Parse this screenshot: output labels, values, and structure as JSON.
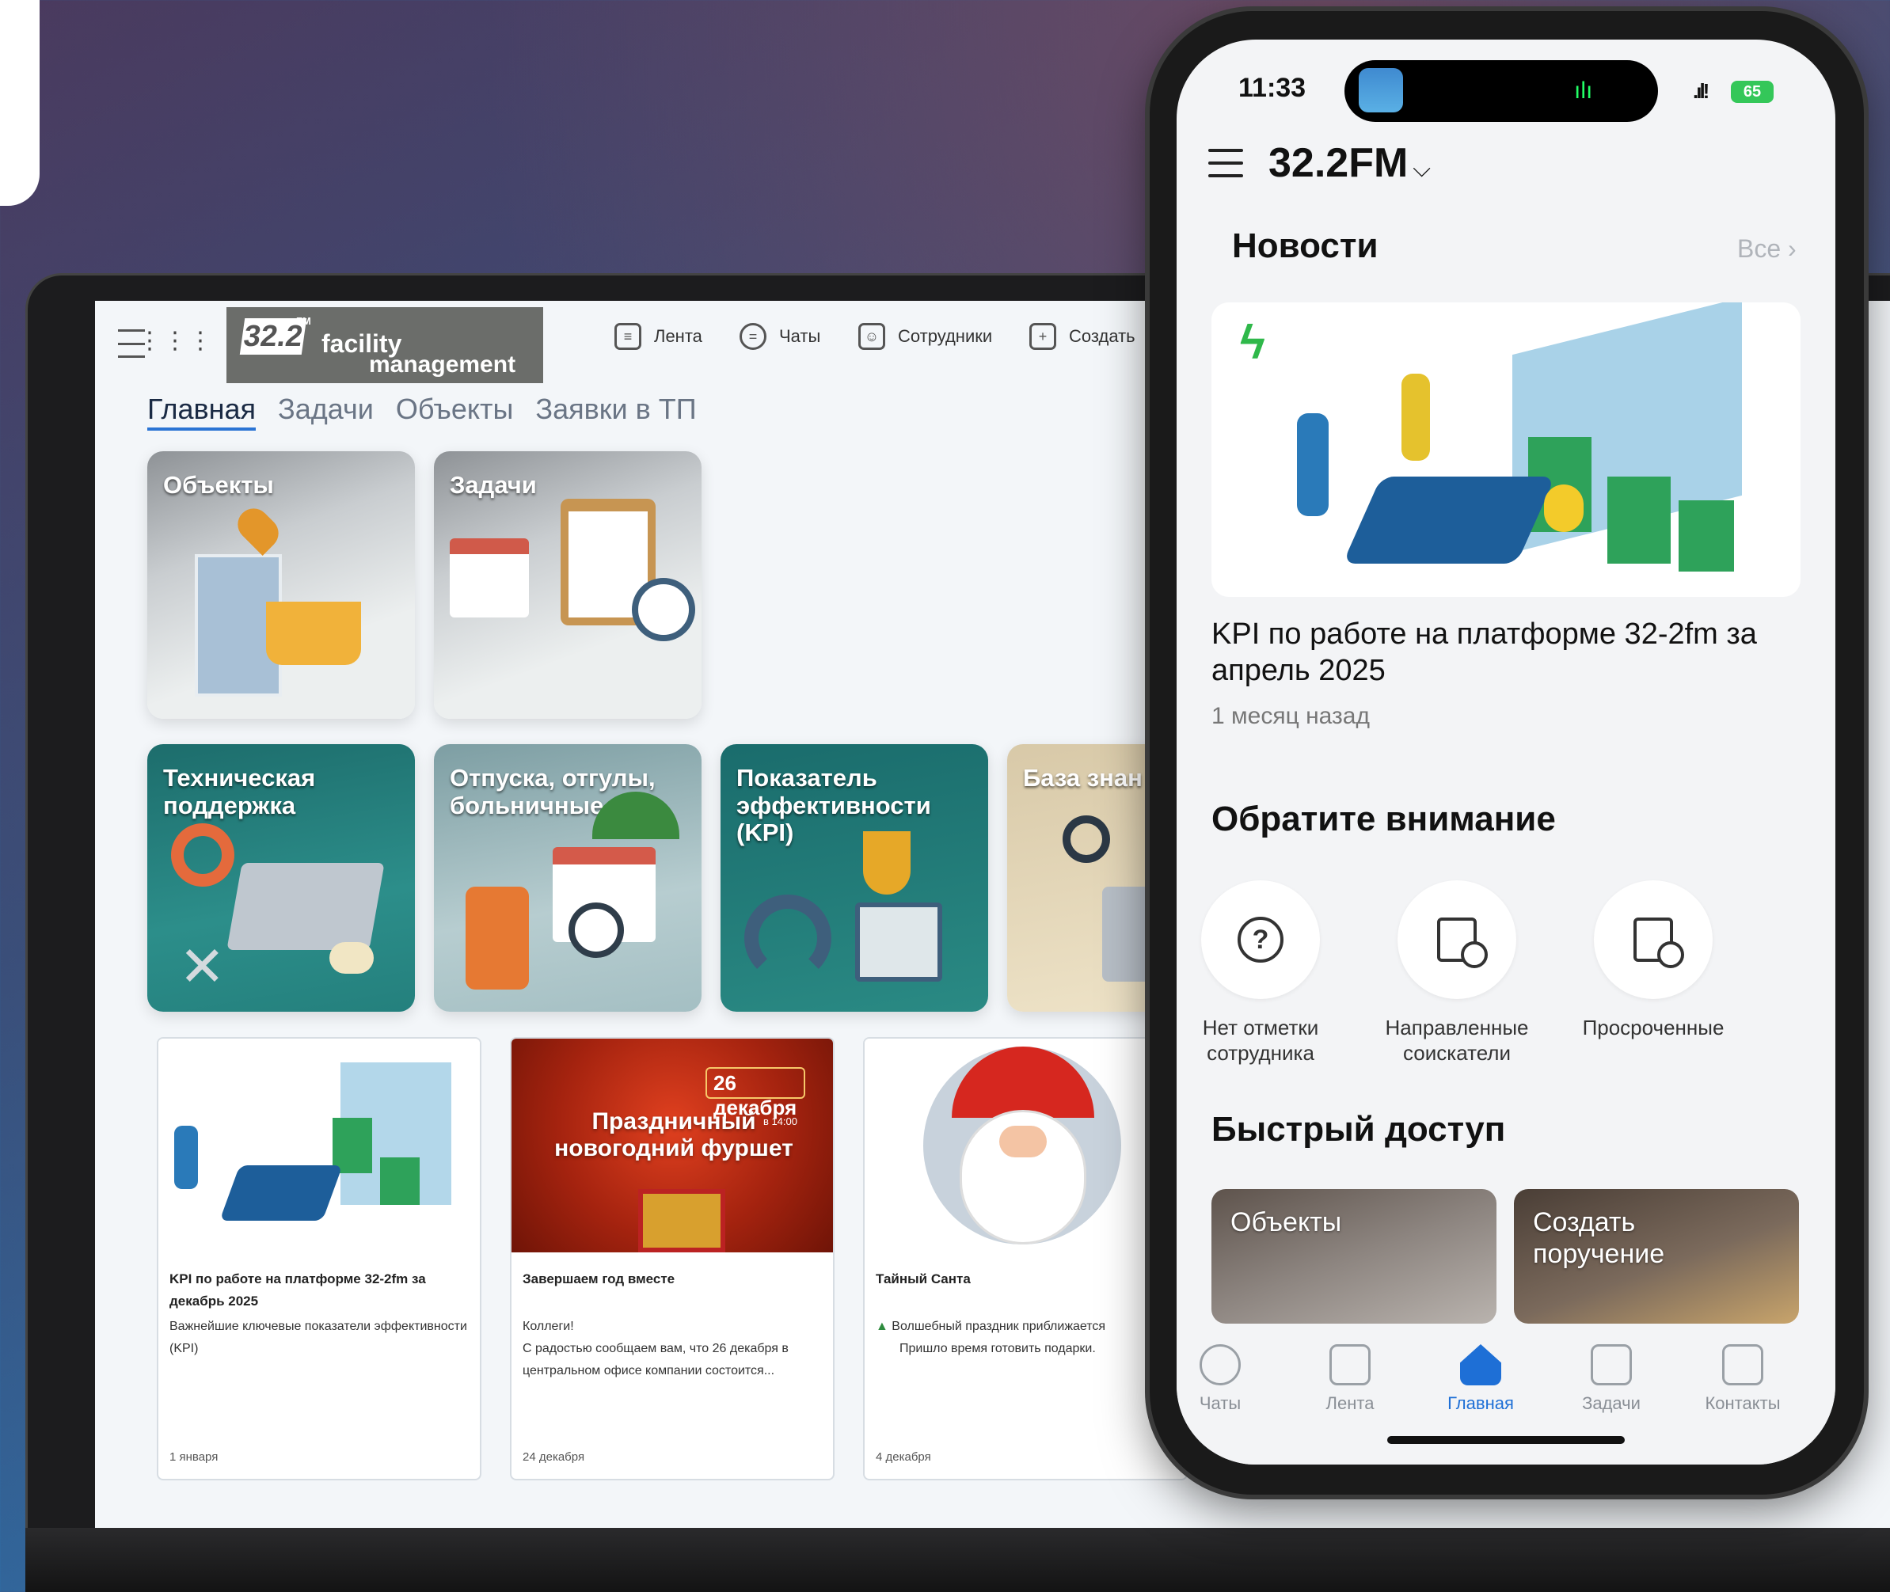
{
  "laptop": {
    "logo": {
      "number": "32.2",
      "super": "FM",
      "line1": "facility",
      "line2": "management"
    },
    "nav": [
      {
        "label": "Лента",
        "icon": "feed-icon"
      },
      {
        "label": "Чаты",
        "icon": "chat-icon"
      },
      {
        "label": "Сотрудники",
        "icon": "employees-icon"
      },
      {
        "label": "Создать",
        "icon": "plus-icon"
      }
    ],
    "tabs": [
      "Главная",
      "Задачи",
      "Объекты",
      "Заявки в ТП"
    ],
    "cards": [
      "Объекты",
      "Задачи",
      "Техническая поддержка",
      "Отпуска, отгулы, больничные",
      "Показатель эффективности (KPI)",
      "База знан"
    ],
    "news": [
      {
        "title": "KPI по работе на платформе 32-2fm за декабрь 2025",
        "text": "Важнейшие ключевые показатели эффективности (KPI)",
        "date": "1 января"
      },
      {
        "title": "Завершаем год вместе",
        "text": "Коллеги!\nС радостью сообщаем вам, что 26 декабря в центральном офисе компании состоится...",
        "date": "24 декабря",
        "banner_date": "26 декабря",
        "banner_time": "в 14:00",
        "banner_title": "Праздничный новогодний фуршет"
      },
      {
        "title": "Тайный Санта",
        "text": "Волшебный праздник приближается\nПришло время готовить подарки.",
        "date": "4 декабря"
      }
    ]
  },
  "phone": {
    "status": {
      "time": "11:33",
      "battery": "65"
    },
    "brand": "32.2FM",
    "news_section": "Новости",
    "see_all": "Все",
    "news": {
      "title": "KPI по работе на платформе 32-2fm за апрель 2025",
      "ago": "1 месяц назад"
    },
    "attention_section": "Обратите внимание",
    "attention": [
      {
        "label": "Нет отметки сотрудника",
        "icon": "question-icon"
      },
      {
        "label": "Направленные соискатели",
        "icon": "clock-doc-icon"
      },
      {
        "label": "Просроченные",
        "icon": "clock-doc-icon"
      }
    ],
    "quick_section": "Быстрый доступ",
    "quick": [
      "Объекты",
      "Создать поручение"
    ],
    "tabbar": [
      {
        "label": "Чаты",
        "icon": "chat-icon"
      },
      {
        "label": "Лента",
        "icon": "feed-icon"
      },
      {
        "label": "Главная",
        "icon": "home-icon",
        "active": true
      },
      {
        "label": "Задачи",
        "icon": "tasks-icon"
      },
      {
        "label": "Контакты",
        "icon": "contacts-icon"
      }
    ]
  }
}
